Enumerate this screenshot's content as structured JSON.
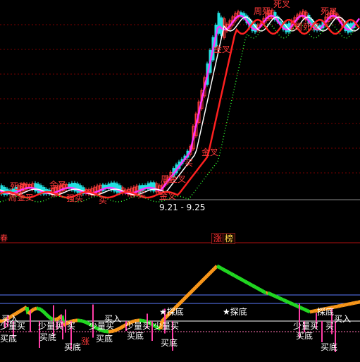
{
  "colors": {
    "background": "#000000",
    "grid_red": "#7a0000",
    "hline_blue": "#5b7bff",
    "price_white": "#ffffff",
    "ma_magenta": "#ff33ff",
    "ma_red": "#ff2020",
    "ma_green_dots": "#33ff33",
    "osc_orange": "#ff9a1a",
    "osc_green": "#22dd22",
    "bar_pink": "#ff3da6"
  },
  "upper_panel": {
    "date_range": "9.21 - 9.25",
    "labels": {
      "jincha": "金叉",
      "sicha": "死叉",
      "mai": "买",
      "zhou_jincha": "周金叉",
      "zhou_sicha": "周死叉",
      "zhou_si": "周死",
      "qiang_mai": "强买"
    }
  },
  "divider": {
    "left_mark": "春",
    "tag_zhang": "涨",
    "tag_bang": "榜"
  },
  "lower_panel": {
    "labels": {
      "tandi": "探底",
      "star_tandi": "★探底",
      "maidi": "买底",
      "xiaoliang_mai": "少量买",
      "mairu": "买入",
      "mai": "买",
      "zhang": "涨"
    }
  }
}
